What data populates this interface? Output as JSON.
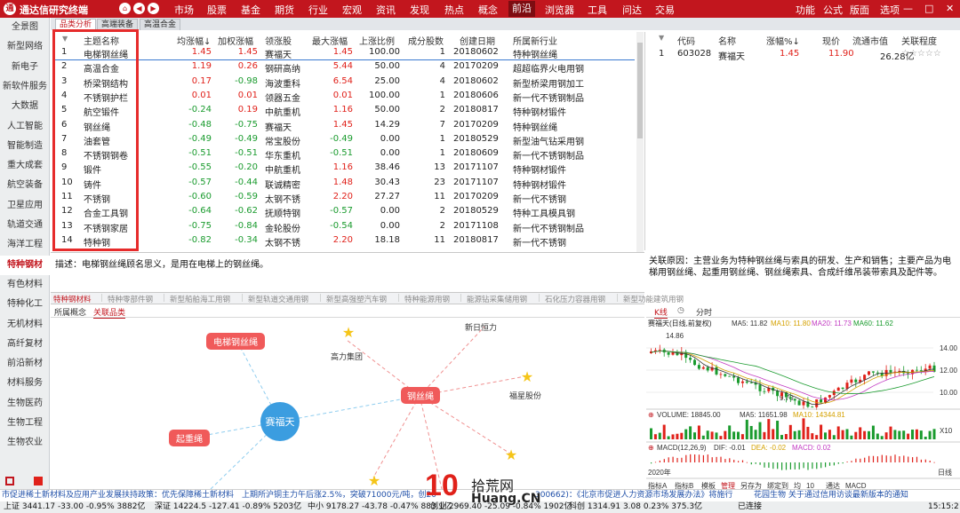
{
  "app": {
    "title": "通达信研究终端"
  },
  "menu": [
    "市场",
    "股票",
    "基金",
    "期货",
    "行业",
    "宏观",
    "资讯",
    "发现",
    "热点",
    "概念",
    "前沿",
    "浏览器",
    "工具",
    "问达",
    "交易"
  ],
  "menu_active": "前沿",
  "window_controls": [
    "功能",
    "公式",
    "版面",
    "选项"
  ],
  "sidebar": [
    "全景图",
    "新型网络",
    "新电子",
    "新软件服务",
    "大数据",
    "人工智能",
    "智能制造",
    "重大成套",
    "航空装备",
    "卫星应用",
    "轨道交通",
    "海洋工程",
    "特种钢材",
    "有色材料",
    "特种化工",
    "无机材料",
    "高纤复材",
    "前沿新材",
    "材料服务",
    "生物医药",
    "生物工程",
    "生物农业"
  ],
  "sidebar_active": "特种钢材",
  "subtabs": [
    "品类分析",
    "高端装备",
    "高温合金"
  ],
  "subtab_active": "品类分析",
  "table": {
    "headers": [
      "主题名称",
      "均涨幅↓",
      "加权涨幅",
      "领涨股",
      "最大涨幅",
      "上涨比例",
      "成分股数",
      "创建日期",
      "所属新行业"
    ],
    "rows": [
      {
        "no": "1",
        "name": "电梯钢丝绳",
        "avg": "1.45",
        "wavg": "1.45",
        "lead": "赛福天",
        "max": "1.45",
        "ratio": "100.00",
        "count": "1",
        "date": "20180602",
        "ind": "特种钢丝绳"
      },
      {
        "no": "2",
        "name": "高温合金",
        "avg": "1.19",
        "wavg": "0.26",
        "lead": "钢研高纳",
        "max": "5.44",
        "ratio": "50.00",
        "count": "4",
        "date": "20170209",
        "ind": "超超临界火电用钢"
      },
      {
        "no": "3",
        "name": "桥梁钢结构",
        "avg": "0.17",
        "wavg": "-0.98",
        "lead": "海波重科",
        "max": "6.54",
        "ratio": "25.00",
        "count": "4",
        "date": "20180602",
        "ind": "新型桥梁用钢加工"
      },
      {
        "no": "4",
        "name": "不锈钢护栏",
        "avg": "0.01",
        "wavg": "0.01",
        "lead": "领器五金",
        "max": "0.01",
        "ratio": "100.00",
        "count": "1",
        "date": "20180606",
        "ind": "新一代不锈钢制品"
      },
      {
        "no": "5",
        "name": "航空锻件",
        "avg": "-0.24",
        "wavg": "0.19",
        "lead": "中航重机",
        "max": "1.16",
        "ratio": "50.00",
        "count": "2",
        "date": "20180817",
        "ind": "特种钢材锻件"
      },
      {
        "no": "6",
        "name": "钢丝绳",
        "avg": "-0.48",
        "wavg": "-0.75",
        "lead": "赛福天",
        "max": "1.45",
        "ratio": "14.29",
        "count": "7",
        "date": "20170209",
        "ind": "特种钢丝绳"
      },
      {
        "no": "7",
        "name": "油套管",
        "avg": "-0.49",
        "wavg": "-0.49",
        "lead": "常宝股份",
        "max": "-0.49",
        "ratio": "0.00",
        "count": "1",
        "date": "20180529",
        "ind": "新型油气钻采用钢"
      },
      {
        "no": "8",
        "name": "不锈钢钢卷",
        "avg": "-0.51",
        "wavg": "-0.51",
        "lead": "华东重机",
        "max": "-0.51",
        "ratio": "0.00",
        "count": "1",
        "date": "20180609",
        "ind": "新一代不锈钢制品"
      },
      {
        "no": "9",
        "name": "锻件",
        "avg": "-0.55",
        "wavg": "-0.20",
        "lead": "中航重机",
        "max": "1.16",
        "ratio": "38.46",
        "count": "13",
        "date": "20171107",
        "ind": "特种钢材锻件"
      },
      {
        "no": "10",
        "name": "铸件",
        "avg": "-0.57",
        "wavg": "-0.44",
        "lead": "联诚精密",
        "max": "1.48",
        "ratio": "30.43",
        "count": "23",
        "date": "20171107",
        "ind": "特种钢材锻件"
      },
      {
        "no": "11",
        "name": "不锈钢",
        "avg": "-0.60",
        "wavg": "-0.59",
        "lead": "太钢不锈",
        "max": "2.20",
        "ratio": "27.27",
        "count": "11",
        "date": "20170209",
        "ind": "新一代不锈钢"
      },
      {
        "no": "12",
        "name": "合金工具钢",
        "avg": "-0.64",
        "wavg": "-0.62",
        "lead": "抚顺特钢",
        "max": "-0.57",
        "ratio": "0.00",
        "count": "2",
        "date": "20180529",
        "ind": "特种工具模具钢"
      },
      {
        "no": "13",
        "name": "不锈钢家居",
        "avg": "-0.75",
        "wavg": "-0.84",
        "lead": "金轮股份",
        "max": "-0.54",
        "ratio": "0.00",
        "count": "2",
        "date": "20171108",
        "ind": "新一代不锈钢制品"
      },
      {
        "no": "14",
        "name": "特种钢",
        "avg": "-0.82",
        "wavg": "-0.34",
        "lead": "太钢不锈",
        "max": "2.20",
        "ratio": "18.18",
        "count": "11",
        "date": "20180817",
        "ind": "新一代不锈钢"
      }
    ]
  },
  "right_table": {
    "headers": [
      "代码",
      "名称",
      "涨幅%↓",
      "现价",
      "流通市值",
      "关联程度"
    ],
    "rows": [
      {
        "no": "1",
        "code": "603028",
        "name": "赛福天",
        "chg": "1.45",
        "price": "11.90",
        "cap": "26.28亿",
        "rel": "☆☆☆☆☆"
      }
    ]
  },
  "description": "描述：电梯钢丝绳顾名思义，是用在电梯上的钢丝绳。",
  "reason": "关联原因：主营业务为特种钢丝绳与索具的研发、生产和销售；主要产品为电梯用钢丝绳、起重用钢丝绳、钢丝绳索具、合成纤维吊装带索具及配件等。",
  "category_tabs": [
    "特种钢材料",
    "特种零部件钢",
    "新型船舶海工用钢",
    "新型轨道交通用钢",
    "新型高强塑汽车钢",
    "特种能源用钢",
    "能源钻采集储用钢",
    "石化压力容器用钢",
    "新型功能建筑用钢"
  ],
  "graph_tabs": [
    "所属概念",
    "关联品类"
  ],
  "graph_tab_active": "关联品类",
  "graph_nodes": {
    "center": "赛福天",
    "steel_rope": "钢丝绳",
    "elevator": "电梯钢丝绳",
    "lifting": "起重绳",
    "gaoli": "高力集团",
    "xinri": "新日恒力",
    "fuxing": "福星股份"
  },
  "k_tabs": [
    "K线",
    "分时"
  ],
  "k_chart": {
    "title": "赛福天(日线,前复权)",
    "ma5": "MA5: 11.82",
    "ma10": "MA10: 11.80",
    "ma20": "MA20: 11.73",
    "ma60": "MA60: 11.62",
    "high_label": "14.86",
    "low_label": "9.70",
    "y_ticks": [
      "14.00",
      "12.00",
      "10.00"
    ],
    "volume_label": "VOLUME: 18845.00",
    "vma5": "MA5: 11651.98",
    "vma10": "MA10: 14344.81",
    "vol_unit": "X10",
    "macd_label": "MACD(12,26,9)",
    "dif": "DIF: -0.01",
    "dea": "DEA: -0.02",
    "macd": "MACD: 0.02",
    "year": "2020年",
    "bottom_tabs": [
      "指标A",
      "指标B",
      "模板",
      "管理",
      "另存为",
      "绑定到",
      "均",
      "10",
      "通达",
      "MACD"
    ],
    "extra": "日线"
  },
  "news": {
    "left": "市促进稀土新材料及应用产业发展扶持政策：优先保障稀土新材料",
    "mid": "上期所沪铜主力午后涨2.5%，突破71000元/吨，创20",
    "right": "300662)：《北京市促进人力资源市场发展办法》将施行",
    "notice": "花园生物 关于通过信用访谈最新版本的通知"
  },
  "status": {
    "sh": "上证 3441.17 -33.00 -0.95% 3882亿",
    "sz": "深证 14224.5 -127.41 -0.89% 5203亿",
    "zx": "中小 9178.27 -43.78 -0.47% 883.1亿",
    "cy": "创业 2969.40 -25.09 -0.84% 1902亿",
    "kc": "科创 1314.91 3.08 0.23% 375.3亿",
    "conn": "已连接",
    "time": "15:15:2"
  },
  "watermark": {
    "big": "10",
    "site": "拾荒网",
    "url": "Huang.CN"
  }
}
